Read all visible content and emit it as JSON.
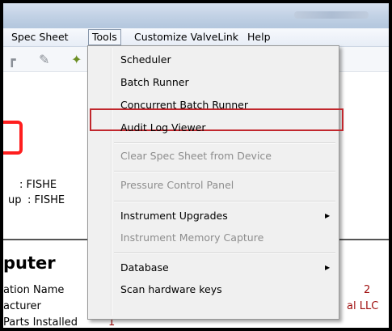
{
  "menubar": {
    "items": [
      "Spec Sheet",
      "Tools",
      "Customize ValveLink",
      "Help"
    ]
  },
  "content": {
    "line1": ": FISHE",
    "line2_prefix": "up",
    "line2_value": ": FISHE",
    "heading": "puter",
    "row1_label": "ation Name",
    "row1_value": "2",
    "row2_label": "acturer",
    "row2_value": "al LLC",
    "row3_label": "Parts Installed",
    "row3_value": "1"
  },
  "dropdown": {
    "items": [
      {
        "label": "Scheduler"
      },
      {
        "label": "Batch Runner"
      },
      {
        "label": "Concurrent Batch Runner"
      },
      {
        "label": "Audit Log Viewer"
      },
      {
        "label": "Clear Spec Sheet from Device"
      },
      {
        "label": "Pressure Control Panel"
      },
      {
        "label": "Instrument Upgrades"
      },
      {
        "label": "Instrument Memory Capture"
      },
      {
        "label": "Database"
      },
      {
        "label": "Scan hardware keys"
      }
    ]
  },
  "highlight_color": "#c1272d"
}
